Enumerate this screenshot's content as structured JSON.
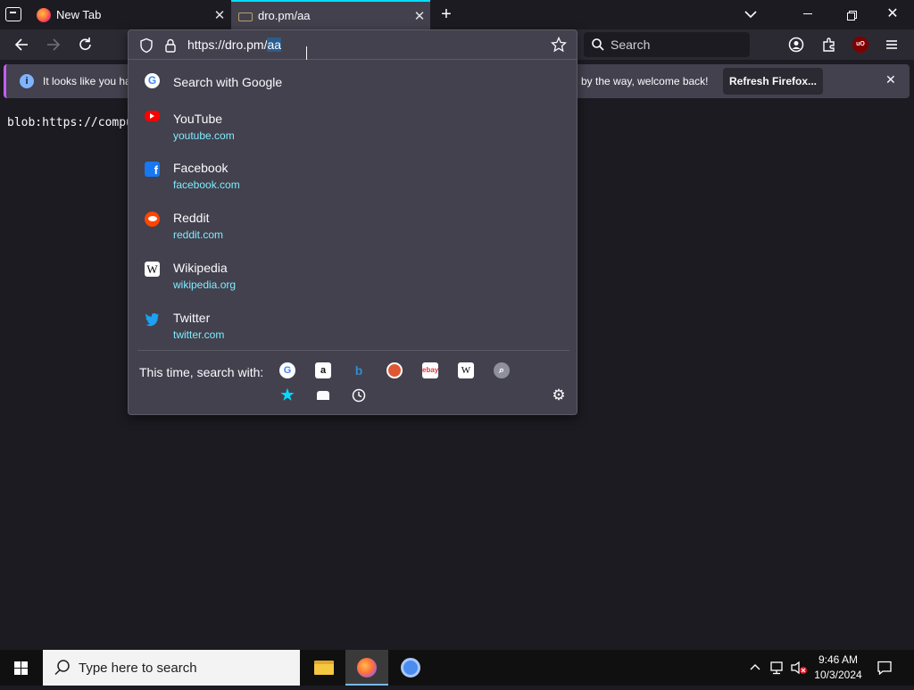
{
  "tabs": [
    {
      "label": "New Tab"
    },
    {
      "label": "dro.pm/aa"
    }
  ],
  "toolbar": {
    "search_placeholder": "Search"
  },
  "notification": {
    "message_start": "It looks like you ha",
    "message_end": "by the way, welcome back!",
    "refresh_label": "Refresh Firefox..."
  },
  "page": {
    "text": "blob:https://compute"
  },
  "urlbar": {
    "url_prefix": "https://dro.pm/",
    "url_selected": "aa",
    "search_suggestion": "Search with Google",
    "results": [
      {
        "title": "YouTube",
        "url": "youtube.com",
        "icon": "youtube-icon",
        "color": "#ff0000"
      },
      {
        "title": "Facebook",
        "url": "facebook.com",
        "icon": "facebook-icon",
        "color": "#1877f2"
      },
      {
        "title": "Reddit",
        "url": "reddit.com",
        "icon": "reddit-icon",
        "color": "#ff4500"
      },
      {
        "title": "Wikipedia",
        "url": "wikipedia.org",
        "icon": "wikipedia-icon",
        "color": "#ffffff"
      },
      {
        "title": "Twitter",
        "url": "twitter.com",
        "icon": "twitter-icon",
        "color": "#1da1f2"
      }
    ],
    "search_with_label": "This time, search with:",
    "engines": [
      "google",
      "amazon",
      "bing",
      "duckduckgo",
      "ebay",
      "wikipedia",
      "search"
    ],
    "modes": [
      "bookmarks",
      "tabs",
      "history"
    ]
  },
  "taskbar": {
    "search_placeholder": "Type here to search",
    "time": "9:46 AM",
    "date": "10/3/2024"
  },
  "colors": {
    "accent": "#00ddff",
    "link": "#80ebff",
    "panel": "#42414d",
    "background": "#1c1b22"
  }
}
